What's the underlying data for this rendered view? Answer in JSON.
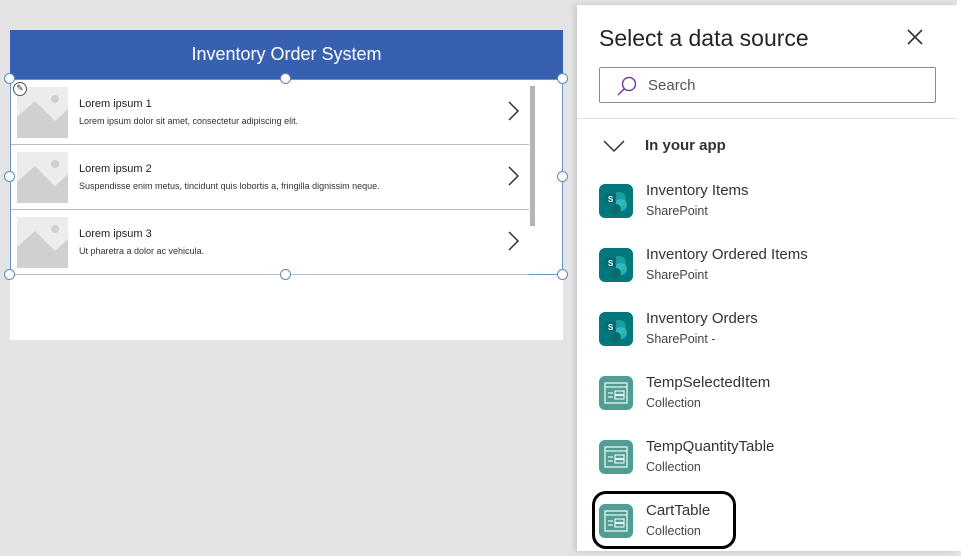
{
  "app": {
    "title": "Inventory Order System",
    "gallery": [
      {
        "title": "Lorem ipsum 1",
        "subtitle": "Lorem ipsum dolor sit amet, consectetur adipiscing elit."
      },
      {
        "title": "Lorem ipsum 2",
        "subtitle": "Suspendisse enim metus, tincidunt quis lobortis a, fringilla dignissim neque."
      },
      {
        "title": "Lorem ipsum 3",
        "subtitle": "Ut pharetra a dolor ac vehicula."
      }
    ]
  },
  "panel": {
    "title": "Select a data source",
    "search_placeholder": "Search",
    "section": "In your app",
    "items": [
      {
        "name": "Inventory Items",
        "type": "SharePoint",
        "icon": "sharepoint-icon"
      },
      {
        "name": "Inventory Ordered Items",
        "type": "SharePoint",
        "icon": "sharepoint-icon"
      },
      {
        "name": "Inventory Orders",
        "type": "SharePoint -",
        "icon": "sharepoint-icon"
      },
      {
        "name": "TempSelectedItem",
        "type": "Collection",
        "icon": "collection-icon"
      },
      {
        "name": "TempQuantityTable",
        "type": "Collection",
        "icon": "collection-icon"
      },
      {
        "name": "CartTable",
        "type": "Collection",
        "icon": "collection-icon"
      }
    ]
  },
  "colors": {
    "header": "#3760b1",
    "sharepoint": "#03787c",
    "collection": "#4f9d93"
  }
}
